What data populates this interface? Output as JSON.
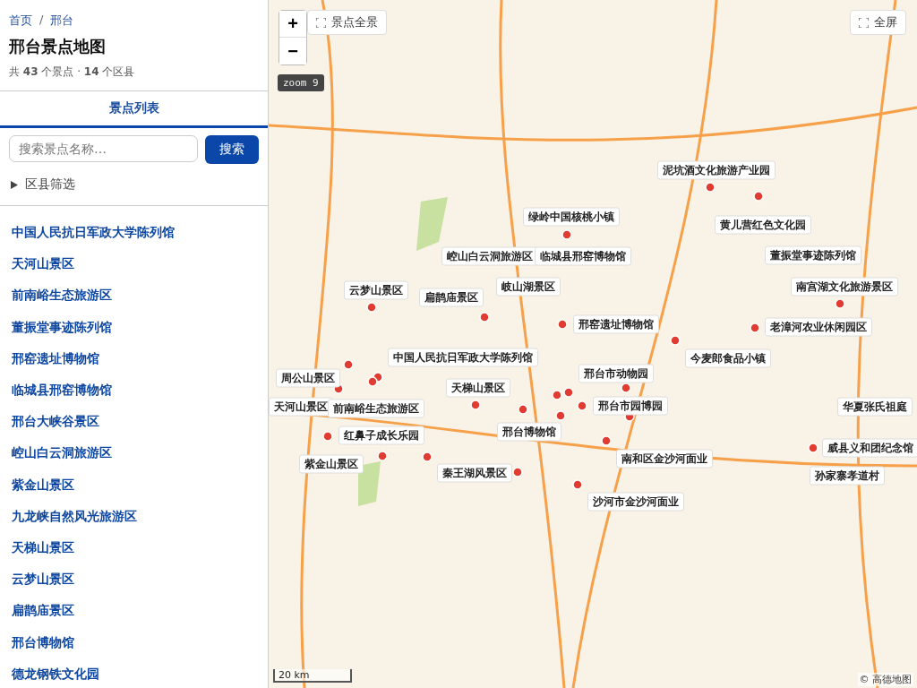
{
  "breadcrumb": [
    "首页",
    "邢台"
  ],
  "breadcrumb_separator": "/",
  "title": "邢台景点地图",
  "summary": "共 **43** 个景点 · **14** 个区县",
  "tabs": [
    {
      "label": "景点列表",
      "selected": true
    }
  ],
  "search": {
    "placeholder": "搜索景点名称…",
    "button": "搜索"
  },
  "filter": {
    "label": "区县筛选",
    "expanded": false
  },
  "spots": [
    "中国人民抗日军政大学陈列馆",
    "天河山景区",
    "前南峪生态旅游区",
    "董振堂事迹陈列馆",
    "邢窑遗址博物馆",
    "临城县邢窑博物馆",
    "邢台大峡谷景区",
    "崆山白云洞旅游区",
    "紫金山景区",
    "九龙峡自然风光旅游区",
    "天梯山景区",
    "云梦山景区",
    "扁鹊庙景区",
    "邢台博物馆",
    "德龙钢铁文化园"
  ],
  "map": {
    "zoom_in": "+",
    "zoom_out": "−",
    "overview_button": "景点全景",
    "fullscreen_button": "全屏",
    "zoom_badge": "zoom 9",
    "scale": "20 km",
    "attribution": "© 高德地图",
    "labels": [
      "泥坑酒文化旅游产业园",
      "绿岭中国核桃小镇",
      "黄儿营红色文化园",
      "崆山白云洞旅游区",
      "临城县邢窑博物馆",
      "董振堂事迹陈列馆",
      "云梦山景区",
      "岐山湖景区",
      "南宫湖文化旅游景区",
      "扁鹊庙景区",
      "邢窑遗址博物馆",
      "老漳河农业休闲园区",
      "中国人民抗日军政大学陈列馆",
      "今麦郎食品小镇",
      "周公山景区",
      "邢台市动物园",
      "天梯山景区",
      "天河山景区",
      "前南峪生态旅游区",
      "邢台市园博园",
      "华夏张氏祖庭",
      "红鼻子成长乐园",
      "邢台博物馆",
      "威县义和团纪念馆",
      "紫金山景区",
      "南和区金沙河面业",
      "秦王湖风景区",
      "孙家寨孝道村",
      "沙河市金沙河面业"
    ]
  }
}
